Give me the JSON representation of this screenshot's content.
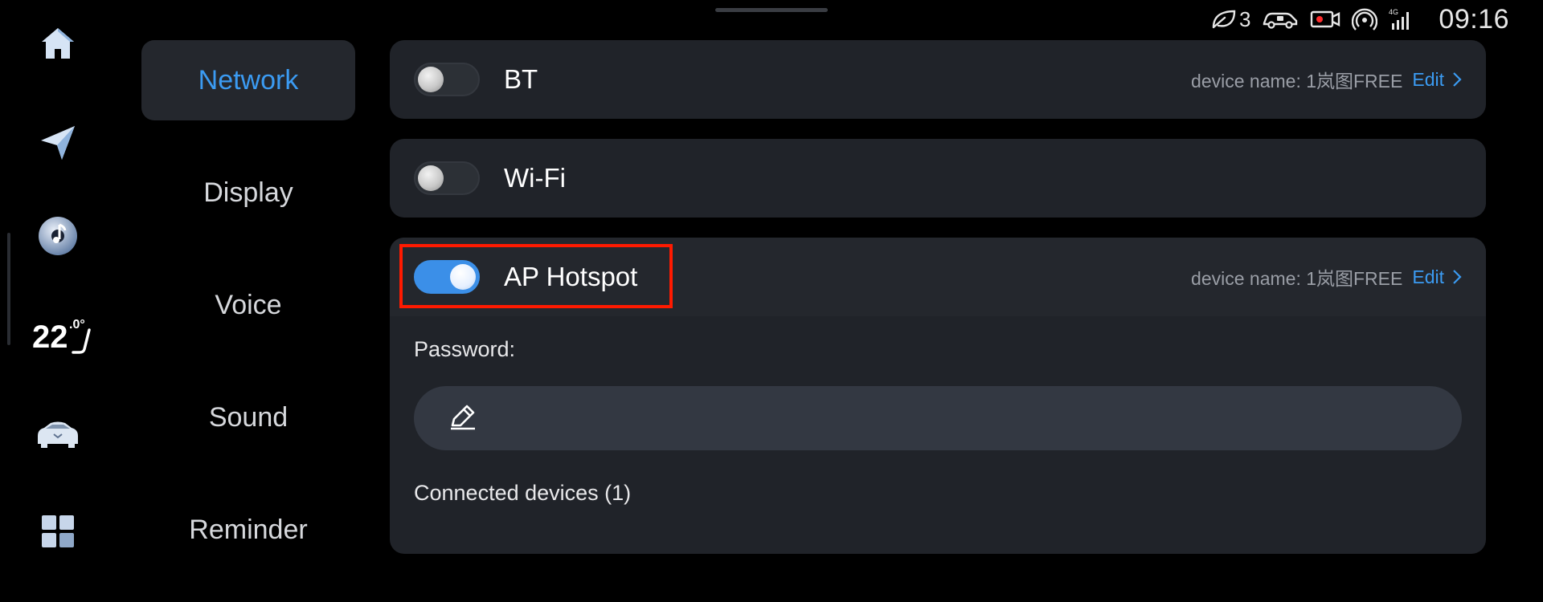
{
  "status_bar": {
    "leaf_count": "3",
    "clock": "09:16",
    "icons": [
      "leaf-icon",
      "car-lock-icon",
      "dashcam-icon",
      "hotspot-signal-icon",
      "cellular-4g-icon"
    ]
  },
  "dock": {
    "icons": [
      "home-icon",
      "navigation-icon",
      "music-icon",
      "climate-icon",
      "vehicle-icon",
      "apps-grid-icon"
    ],
    "temperature": "22",
    "temperature_unit": ".0°"
  },
  "categories": [
    {
      "label": "Network",
      "active": true
    },
    {
      "label": "Display",
      "active": false
    },
    {
      "label": "Voice",
      "active": false
    },
    {
      "label": "Sound",
      "active": false
    },
    {
      "label": "Reminder",
      "active": false
    }
  ],
  "bt": {
    "label": "BT",
    "enabled": false,
    "device_name": "device name: 1岚图FREE",
    "edit_label": "Edit"
  },
  "wifi": {
    "label": "Wi-Fi",
    "enabled": false
  },
  "hotspot": {
    "label": "AP Hotspot",
    "enabled": true,
    "device_name": "device name: 1岚图FREE",
    "edit_label": "Edit",
    "password_label": "Password:",
    "password_value": "",
    "connected_label": "Connected devices (1)"
  },
  "colors": {
    "accent": "#3b9bf2",
    "highlight": "#ff1a00",
    "card_bg": "#202329",
    "toggle_on": "#3b8fe8"
  }
}
